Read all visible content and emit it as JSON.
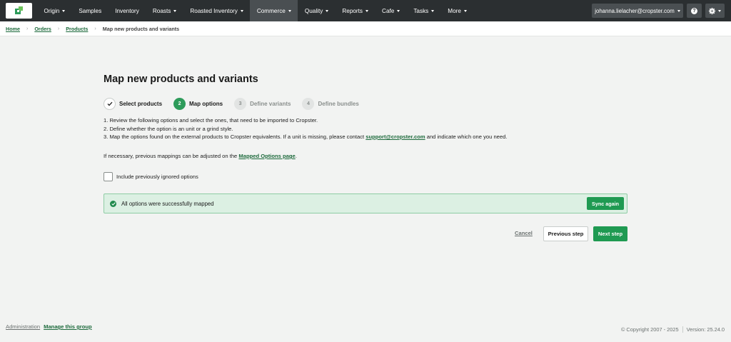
{
  "brand": {
    "logo_icon": "cropster-leaf-icon",
    "accent": "#1f9a52",
    "dark_bar": "#2b2f31"
  },
  "nav": {
    "items": [
      {
        "label": "Origin",
        "dropdown": true
      },
      {
        "label": "Samples",
        "dropdown": false
      },
      {
        "label": "Inventory",
        "dropdown": false
      },
      {
        "label": "Roasts",
        "dropdown": true
      },
      {
        "label": "Roasted Inventory",
        "dropdown": true
      },
      {
        "label": "Commerce",
        "dropdown": true,
        "active": true
      },
      {
        "label": "Quality",
        "dropdown": true
      },
      {
        "label": "Reports",
        "dropdown": true
      },
      {
        "label": "Cafe",
        "dropdown": true
      },
      {
        "label": "Tasks",
        "dropdown": true
      },
      {
        "label": "More",
        "dropdown": true
      }
    ],
    "user_email": "johanna.lielacher@cropster.com",
    "help_icon": "question-circle-icon",
    "settings_icon": "gear-icon"
  },
  "breadcrumb": {
    "items": [
      "Home",
      "Orders",
      "Products"
    ],
    "current": "Map new products and variants"
  },
  "page": {
    "title": "Map new products and variants",
    "steps": [
      {
        "number": "✓",
        "label": "Select products",
        "state": "done"
      },
      {
        "number": "2",
        "label": "Map options",
        "state": "current"
      },
      {
        "number": "3",
        "label": "Define variants",
        "state": "pending"
      },
      {
        "number": "4",
        "label": "Define bundles",
        "state": "pending"
      }
    ],
    "instructions": {
      "line1": "1. Review the following options and select the ones, that need to be imported to Cropster.",
      "line2": "2. Define whether the option is an unit or a grind style.",
      "line3_pre": "3. Map the options found on the external products to Cropster equivalents. If a unit is missing, please contact ",
      "line3_link": "support@cropster.com",
      "line3_post": " and indicate which one you need."
    },
    "mapping_note": {
      "pre": "If necessary, previous mappings can be adjusted on the ",
      "link": "Mapped Options page",
      "post": "."
    },
    "checkbox_label": "Include previously ignored options",
    "alert": {
      "text": "All options were successfully mapped",
      "icon": "check-circle-icon",
      "button": "Sync again"
    },
    "actions": {
      "cancel": "Cancel",
      "previous": "Previous step",
      "next": "Next step"
    }
  },
  "footer": {
    "admin": "Administration",
    "manage": "Manage this group",
    "copyright": "© Copyright 2007 - 2025",
    "version": "Version: 25.24.0"
  }
}
